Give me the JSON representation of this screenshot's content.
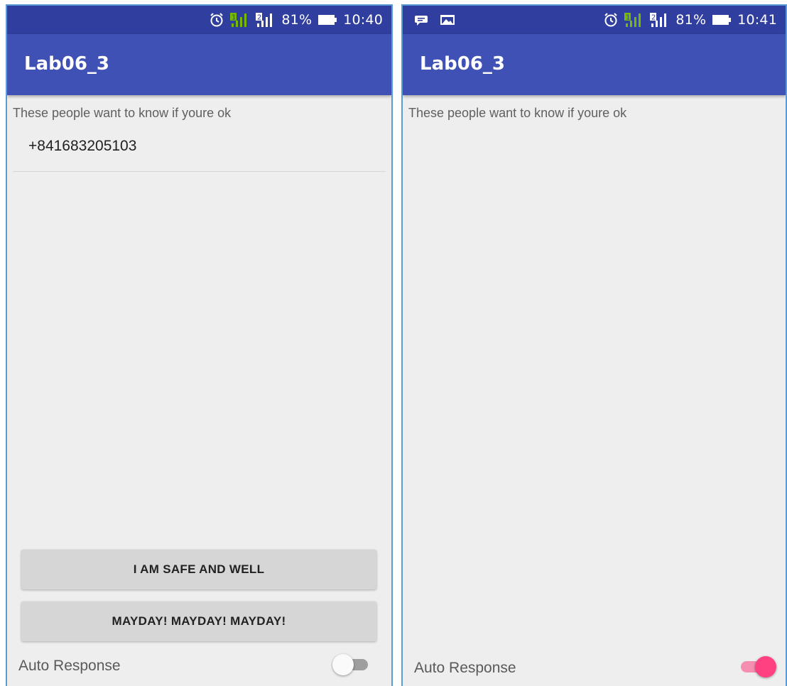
{
  "screens": [
    {
      "status_bar": {
        "icons": [
          "alarm-icon",
          "sim1-signal-icon",
          "sim2-signal-icon",
          "battery-icon"
        ],
        "battery": "81%",
        "time": "10:40"
      },
      "app_title": "Lab06_3",
      "caption": "These people want to know if youre ok",
      "contacts": [
        "+841683205103"
      ],
      "buttons": {
        "safe": "I AM SAFE AND WELL",
        "mayday": "MAYDAY! MAYDAY! MAYDAY!"
      },
      "auto_response": {
        "label": "Auto Response",
        "on": false
      }
    },
    {
      "status_bar": {
        "icons": [
          "message-icon",
          "image-icon",
          "alarm-icon",
          "sim1-signal-icon",
          "sim2-signal-icon",
          "battery-icon"
        ],
        "battery": "81%",
        "time": "10:41"
      },
      "app_title": "Lab06_3",
      "caption": "These people want to know if youre ok",
      "contacts": [],
      "auto_response": {
        "label": "Auto Response",
        "on": true
      }
    }
  ],
  "colors": {
    "status_bar": "#303f9f",
    "app_bar": "#3f51b5",
    "background": "#eeeeee",
    "accent": "#ff4081",
    "sim1": "#76b900",
    "button": "#d6d6d6"
  }
}
